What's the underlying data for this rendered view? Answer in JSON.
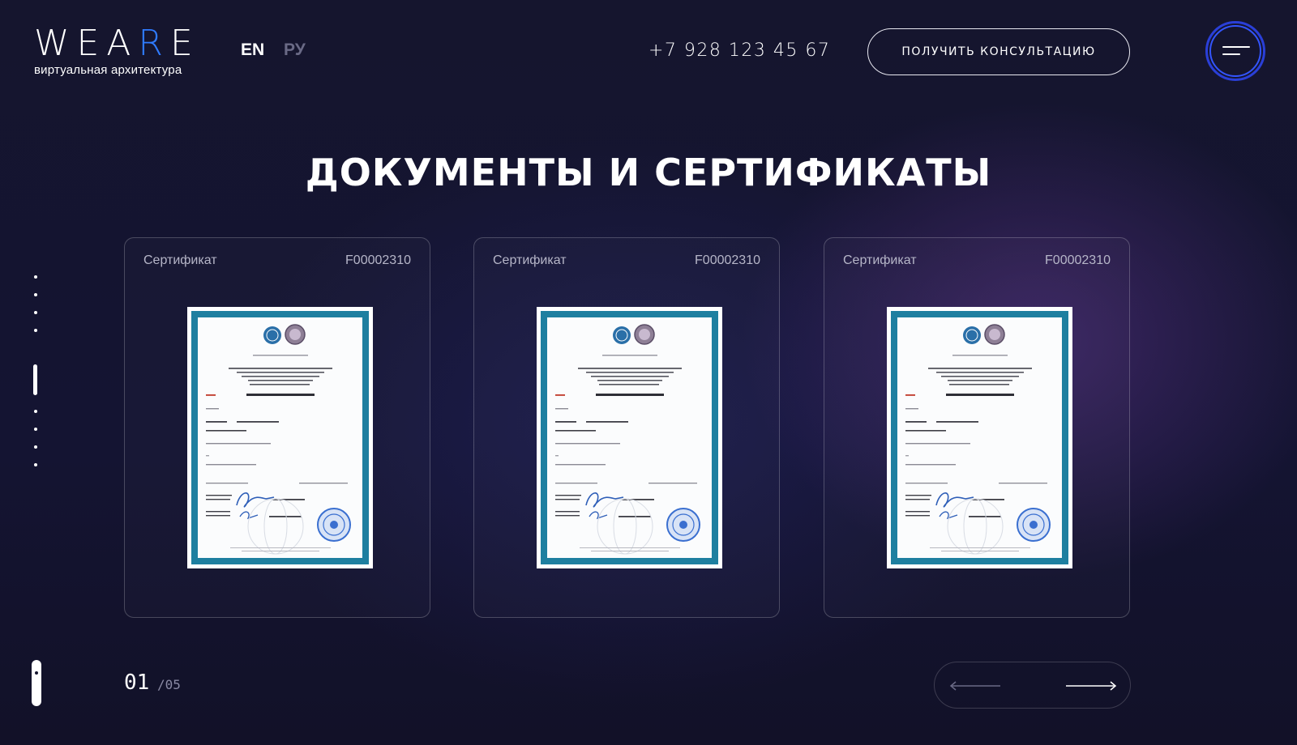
{
  "header": {
    "logo": {
      "word": "WEARE",
      "tagline": "виртуальная архитектура"
    },
    "languages": [
      {
        "code": "EN",
        "active": true
      },
      {
        "code": "РУ",
        "active": false
      }
    ],
    "phone": "+7 928 123 45 67",
    "cta_label": "ПОЛУЧИТЬ КОНСУЛЬТАЦИЮ",
    "menu_icon": "hamburger-menu-icon"
  },
  "page": {
    "title": "ДОКУМЕНТЫ И СЕРТИФИКАТЫ"
  },
  "side_nav": {
    "dots": 9,
    "active_index": 5
  },
  "cards": [
    {
      "type": "Сертификат",
      "number": "F00002310"
    },
    {
      "type": "Сертификат",
      "number": "F00002310"
    },
    {
      "type": "Сертификат",
      "number": "F00002310"
    }
  ],
  "pagination": {
    "current": "01",
    "total": "/05"
  },
  "colors": {
    "background": "#15152e",
    "accent": "#2f7bff",
    "menu_ring": "#2a3fd8",
    "certificate_frame": "#1e7fa0"
  },
  "icons": {
    "prev": "arrow-left-icon",
    "next": "arrow-right-icon"
  }
}
